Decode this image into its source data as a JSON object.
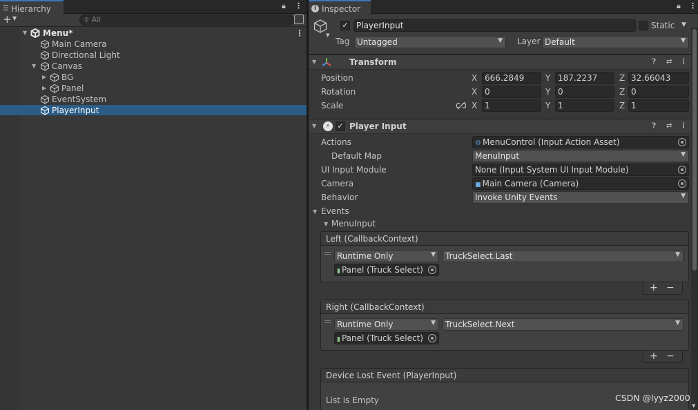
{
  "hierarchy": {
    "tab_label": "Hierarchy",
    "search_placeholder": "All",
    "add_label": "+",
    "items": [
      {
        "label": "Menu*"
      },
      {
        "label": "Main Camera"
      },
      {
        "label": "Directional Light"
      },
      {
        "label": "Canvas"
      },
      {
        "label": "BG"
      },
      {
        "label": "Panel"
      },
      {
        "label": "EventSystem"
      },
      {
        "label": "PlayerInput"
      }
    ]
  },
  "inspector": {
    "tab_label": "Inspector",
    "object_name": "PlayerInput",
    "static_label": "Static",
    "tag_label": "Tag",
    "tag_value": "Untagged",
    "layer_label": "Layer",
    "layer_value": "Default",
    "transform": {
      "title": "Transform",
      "position_label": "Position",
      "rotation_label": "Rotation",
      "scale_label": "Scale",
      "x_label": "X",
      "y_label": "Y",
      "z_label": "Z",
      "position": {
        "x": "666.2849",
        "y": "187.2237",
        "z": "32.66043"
      },
      "rotation": {
        "x": "0",
        "y": "0",
        "z": "0"
      },
      "scale": {
        "x": "1",
        "y": "1",
        "z": "1"
      }
    },
    "player_input": {
      "title": "Player Input",
      "actions_label": "Actions",
      "actions_value": "MenuControl (Input Action Asset)",
      "default_map_label": "Default Map",
      "default_map_value": "MenuInput",
      "ui_module_label": "UI Input Module",
      "ui_module_value": "None (Input System UI Input Module)",
      "camera_label": "Camera",
      "camera_value": "Main Camera (Camera)",
      "behavior_label": "Behavior",
      "behavior_value": "Invoke Unity Events",
      "events_label": "Events",
      "menuinput_label": "MenuInput",
      "events": [
        {
          "title": "Left (CallbackContext)",
          "runtime": "Runtime Only",
          "function": "TruckSelect.Last",
          "object": "Panel (Truck Select)"
        },
        {
          "title": "Right (CallbackContext)",
          "runtime": "Runtime Only",
          "function": "TruckSelect.Next",
          "object": "Panel (Truck Select)"
        }
      ],
      "device_lost_title": "Device Lost Event (PlayerInput)",
      "list_empty": "List is Empty",
      "plus": "+",
      "minus": "−"
    }
  },
  "watermark": "CSDN @lyyz2000",
  "colors": {
    "selection": "#2c5d87",
    "panel": "#383838",
    "tab_accent": "#3a79bb"
  }
}
